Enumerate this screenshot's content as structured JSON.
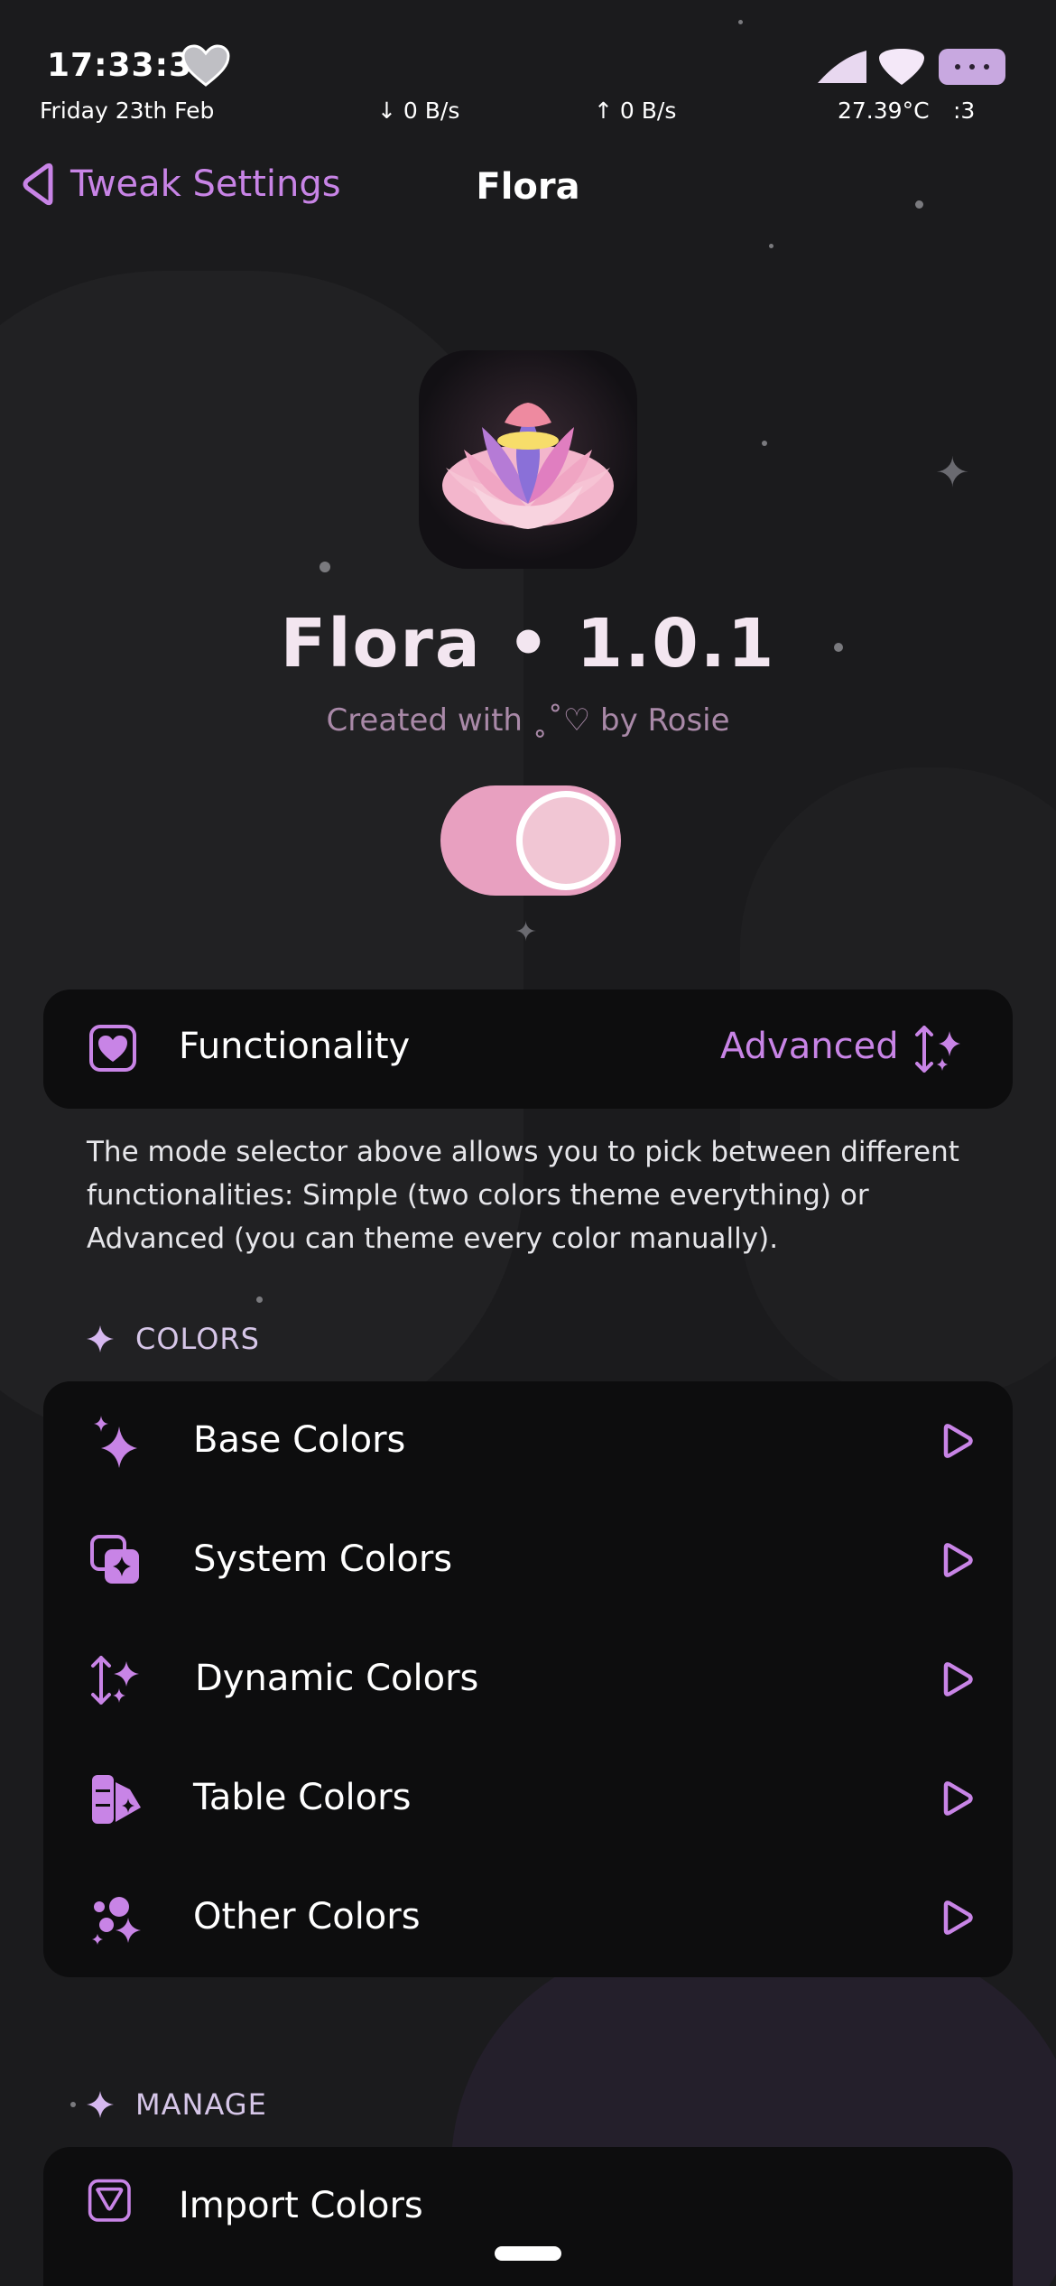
{
  "status_bar": {
    "time": "17:33:37",
    "date": "Friday 23th Feb",
    "download": "↓ 0 B/s",
    "upload": "↑ 0 B/s",
    "temperature": "27.39°C",
    "face": ":3"
  },
  "nav": {
    "back_label": "Tweak Settings",
    "title": "Flora"
  },
  "header": {
    "app_title": "Flora • 1.0.1",
    "subtitle": "Created with ˳˚♡ by Rosie",
    "enabled": true
  },
  "functionality": {
    "label": "Functionality",
    "value": "Advanced",
    "description": "The mode selector above allows you to pick between different functionalities: Simple (two colors theme everything) or Advanced (you can theme every color manually)."
  },
  "colors_section": {
    "header": "COLORS",
    "items": [
      {
        "label": "Base Colors",
        "icon": "sparkles-icon"
      },
      {
        "label": "System Colors",
        "icon": "layered-squares-icon"
      },
      {
        "label": "Dynamic Colors",
        "icon": "arrows-sparkle-icon"
      },
      {
        "label": "Table Colors",
        "icon": "swatch-icon"
      },
      {
        "label": "Other Colors",
        "icon": "bubbles-sparkle-icon"
      }
    ]
  },
  "manage_section": {
    "header": "MANAGE",
    "items": [
      {
        "label": "Import Colors",
        "icon": "import-icon"
      }
    ]
  },
  "colors": {
    "accent": "#c884e6",
    "toggle_track": "#e8a0c0",
    "card": "#0d0d0e",
    "background": "#1b1b1d"
  }
}
